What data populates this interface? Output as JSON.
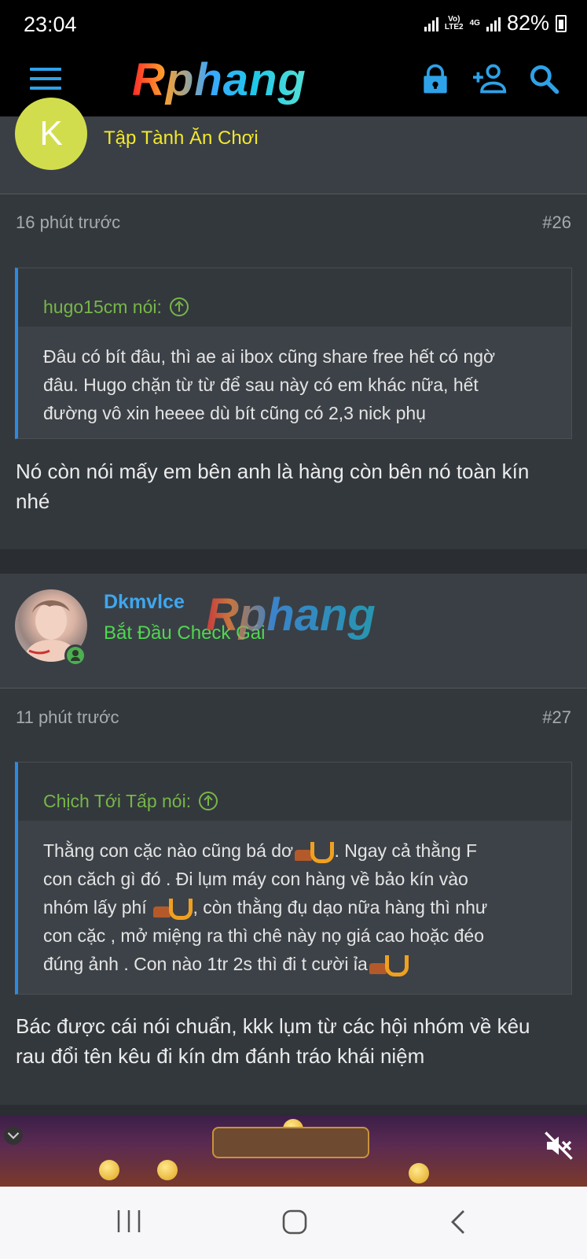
{
  "status_bar": {
    "time": "23:04",
    "network_top": "Vo)",
    "network_bottom": "LTE2",
    "network_type": "4G",
    "battery": "82%"
  },
  "header": {
    "logo": "Rphang",
    "icons": [
      "menu-icon",
      "lock-icon",
      "add-user-icon",
      "search-icon"
    ],
    "accent_color": "#2ea2e8"
  },
  "posts": [
    {
      "avatar_letter": "K",
      "rank": "Tập Tành Ăn Chơi",
      "time": "16 phút trước",
      "number": "#26",
      "quote_author": "hugo15cm nói:",
      "quote_lines": [
        "Đâu có bít đâu, thì ae ai ibox cũng share free hết có ngờ",
        "đâu. Hugo chặn từ từ để sau này có em khác nữa, hết",
        "đường vô xin heeee dù bít cũng có 2,3 nick phụ"
      ],
      "body_lines": [
        "Nó còn nói mấy em bên anh là hàng còn bên nó toàn kín",
        "nhé"
      ]
    },
    {
      "username": "Dkmvlce",
      "rank": "Bắt Đầu Check Gái",
      "time": "11 phút trước",
      "number": "#27",
      "quote_author": "Chịch Tới Tấp nói:",
      "quote_segments": [
        "Thằng con cặc nào cũng bá dơ",
        " . Ngay cả thằng F",
        "con căch gì đó . Đi lụm máy con hàng về bảo kín vào",
        "nhóm lấy phí ",
        " , còn thằng đụ dạo nữa hàng thì như",
        "con cặc , mở miệng ra thì chê này nọ giá cao hoặc đéo",
        "đúng ảnh . Con nào 1tr 2s thì đi t cười ỉa"
      ],
      "body_lines": [
        "Bác được cái nói chuẩn, kkk lụm từ các hội nhóm về kêu",
        "rau đổi tên kêu đi kín dm đánh tráo khái niệm"
      ]
    }
  ],
  "watermark": "Rphang",
  "colors": {
    "rank_yellow": "#f2e82c",
    "rank_green": "#4fd84f",
    "username_blue": "#3ea7f0",
    "quote_author_green": "#77b648",
    "quote_bar_blue": "#2c8be0"
  },
  "nav": [
    "recent-apps-icon",
    "home-icon",
    "back-icon"
  ]
}
